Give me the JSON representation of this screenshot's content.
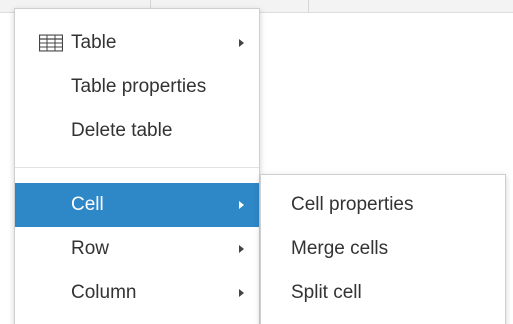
{
  "menu": {
    "items": [
      {
        "label": "Table",
        "icon": "table-icon",
        "has_submenu": true
      },
      {
        "label": "Table properties",
        "has_submenu": false
      },
      {
        "label": "Delete table",
        "has_submenu": false
      },
      {
        "label": "Cell",
        "has_submenu": true,
        "active": true
      },
      {
        "label": "Row",
        "has_submenu": true
      },
      {
        "label": "Column",
        "has_submenu": true
      }
    ]
  },
  "submenu": {
    "items": [
      {
        "label": "Cell properties"
      },
      {
        "label": "Merge cells"
      },
      {
        "label": "Split cell"
      }
    ]
  },
  "colors": {
    "active_background": "#2e87c7",
    "active_text": "#ffffff",
    "text": "#333333"
  }
}
